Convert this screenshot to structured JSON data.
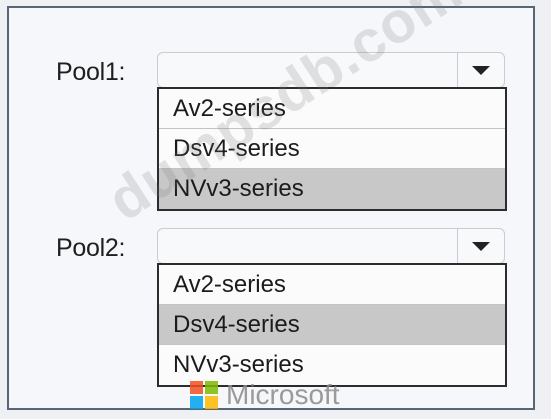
{
  "pool1": {
    "label": "Pool1:",
    "selected_value": "",
    "options": [
      {
        "label": "Av2-series",
        "highlighted": false
      },
      {
        "label": "Dsv4-series",
        "highlighted": false
      },
      {
        "label": "NVv3-series",
        "highlighted": true
      }
    ]
  },
  "pool2": {
    "label": "Pool2:",
    "selected_value": "",
    "options": [
      {
        "label": "Av2-series",
        "highlighted": false
      },
      {
        "label": "Dsv4-series",
        "highlighted": true
      },
      {
        "label": "NVv3-series",
        "highlighted": false
      }
    ]
  },
  "watermark": {
    "text": "dumpsdb.com"
  },
  "brand": {
    "name": "Microsoft",
    "logo_colors": [
      "#f25022",
      "#7fba00",
      "#00a4ef",
      "#ffb900"
    ]
  },
  "colors": {
    "highlight": "#c8c8c8",
    "frame_border": "#5a6477"
  },
  "icons": {
    "dropdown": "chevron-down-icon",
    "logo": "microsoft-logo-icon"
  }
}
